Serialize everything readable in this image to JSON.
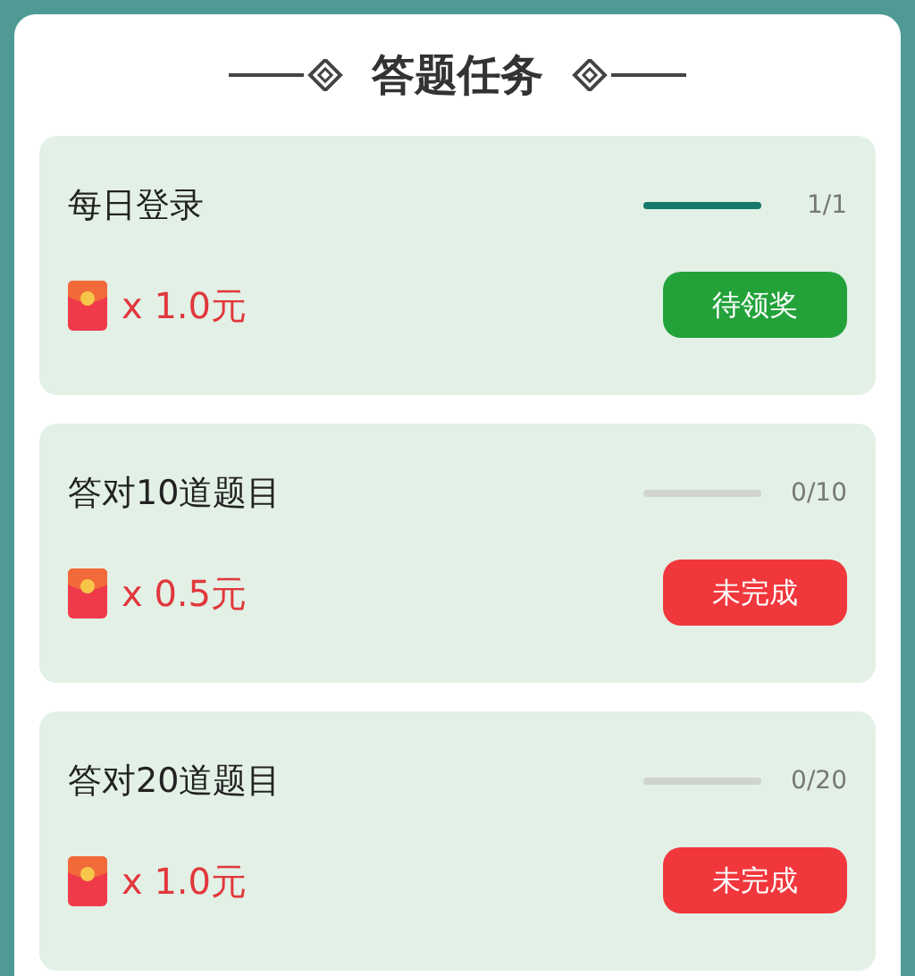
{
  "title": "答题任务",
  "tasks": [
    {
      "name": "每日登录",
      "level": 1,
      "progress": "1/1",
      "reward": "x 1.0元",
      "button": {
        "label": "待领奖",
        "kind": "claim"
      }
    },
    {
      "name": "答对10道题目",
      "level": 0,
      "progress": "0/10",
      "reward": "x 0.5元",
      "button": {
        "label": "未完成",
        "kind": "incomplete"
      }
    },
    {
      "name": "答对20道题目",
      "level": 0,
      "progress": "0/20",
      "reward": "x 1.0元",
      "button": {
        "label": "未完成",
        "kind": "incomplete"
      }
    }
  ]
}
